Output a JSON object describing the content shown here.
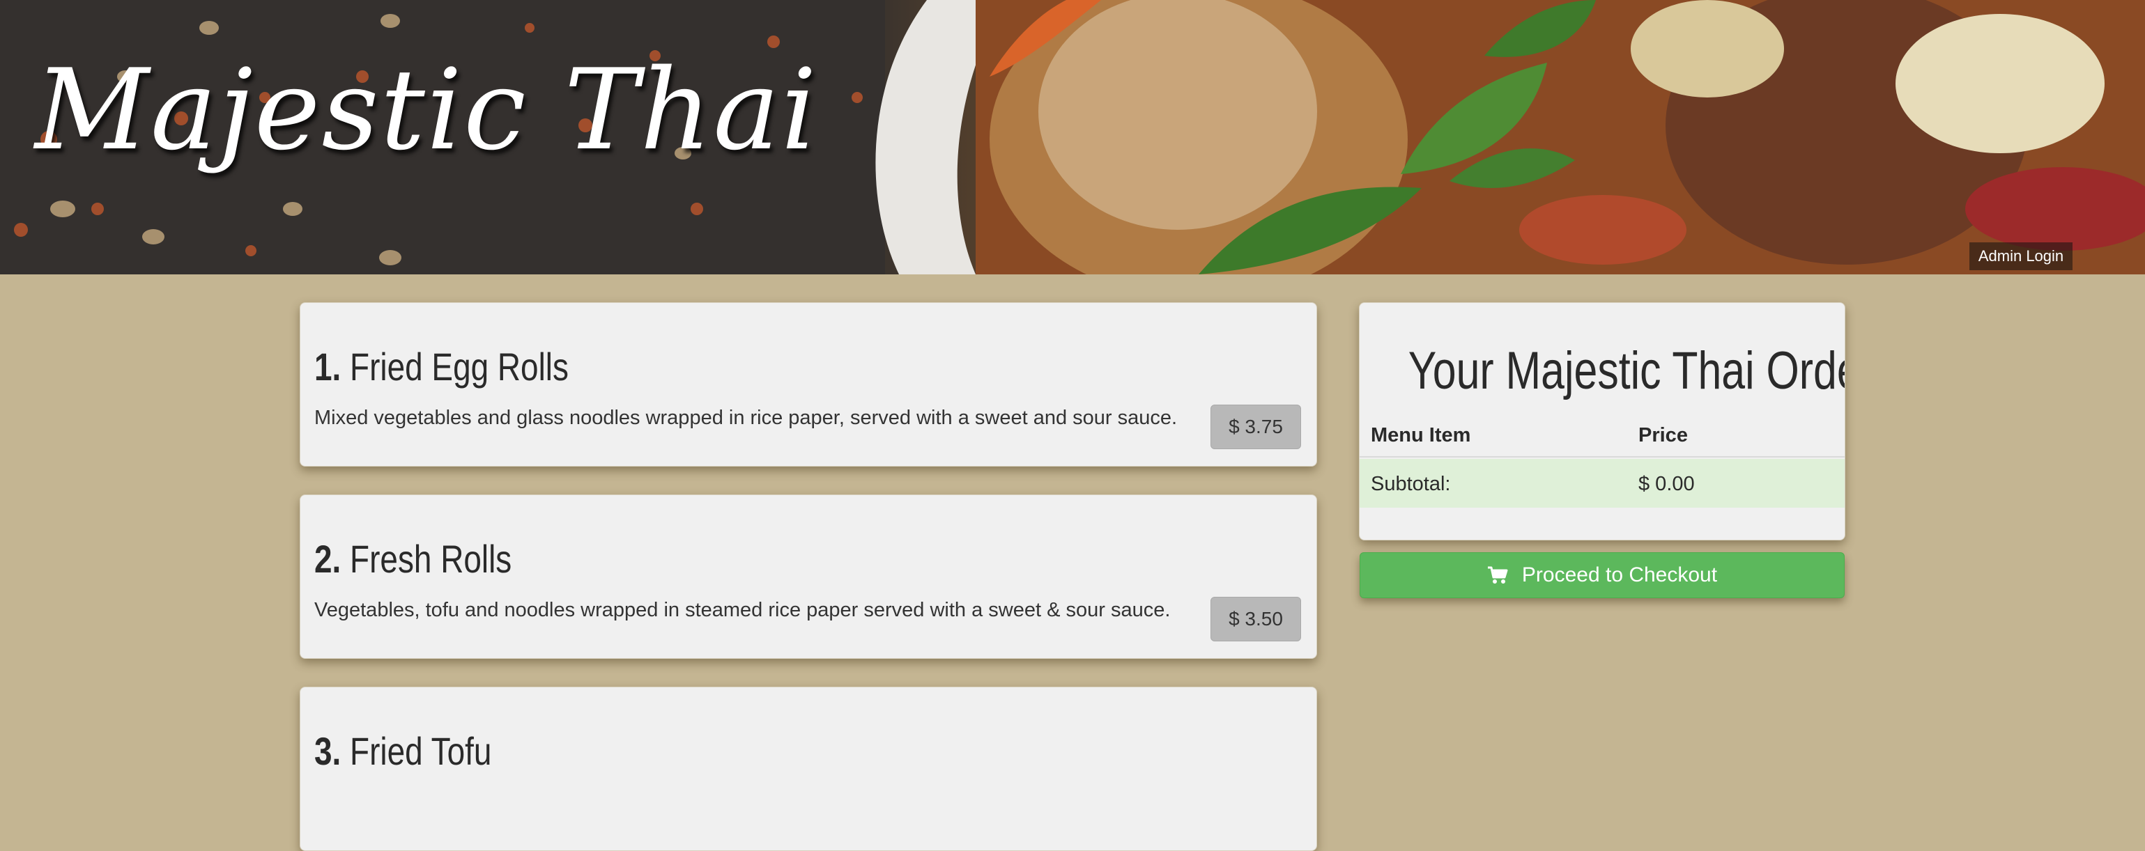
{
  "header": {
    "site_title": "Majestic Thai",
    "admin_login_label": "Admin Login",
    "banner_image": "thai-curry-with-basil"
  },
  "menu": {
    "items": [
      {
        "number": "1.",
        "name": "Fried Egg Rolls",
        "description": "Mixed vegetables and glass noodles wrapped in rice paper, served with a sweet and sour sauce.",
        "price": "$ 3.75"
      },
      {
        "number": "2.",
        "name": "Fresh Rolls",
        "description": "Vegetables, tofu and noodles wrapped in steamed rice paper served with a sweet & sour sauce.",
        "price": "$ 3.50"
      },
      {
        "number": "3.",
        "name": "Fried Tofu"
      }
    ]
  },
  "order": {
    "title": "Your Majestic Thai Order:",
    "col_item": "Menu Item",
    "col_price": "Price",
    "subtotal_label": "Subtotal:",
    "subtotal_value": "$ 0.00",
    "checkout_label": "Proceed to Checkout",
    "checkout_icon": "shopping-cart-icon"
  },
  "colors": {
    "page_background": "#c4b592",
    "card_background": "#f0f0f0",
    "price_button": "#b8b8b8",
    "subtotal_row": "#dff0d8",
    "checkout_green": "#5cb85c"
  }
}
